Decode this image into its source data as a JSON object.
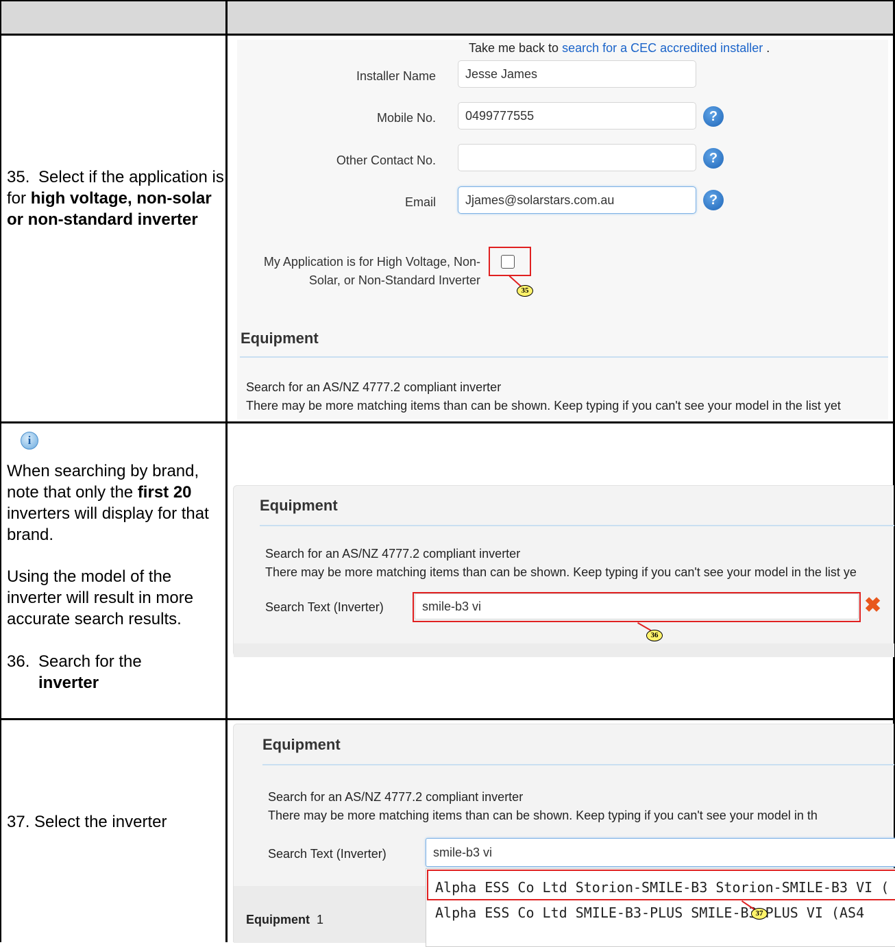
{
  "row35": {
    "instruction_num": "35.",
    "instruction_pre": "Select if the application is for ",
    "instruction_bold": "high voltage, non-solar or non-standard inverter",
    "take_me_back": "Take me back to ",
    "link_text": "search for a CEC accredited installer",
    "link_after": ".",
    "installer_name_label": "Installer Name",
    "installer_name_value": "Jesse James",
    "mobile_label": "Mobile No.",
    "mobile_value": "0499777555",
    "other_contact_label": "Other Contact No.",
    "other_contact_value": "",
    "email_label": "Email",
    "email_value": "Jjames@solarstars.com.au",
    "hv_label_line1": "My Application is for High Voltage, Non-",
    "hv_label_line2": "Solar, or Non-Standard Inverter",
    "badge": "35",
    "equipment_heading": "Equipment",
    "search_line1": "Search for an AS/NZ 4777.2 compliant inverter",
    "search_line2": "There may be more matching items than can be shown. Keep typing if you can't see your model in the list yet"
  },
  "row36": {
    "note_line1": "When searching by brand, note that only the ",
    "note_bold": "first 20",
    "note_line2": " inverters will display for that brand.",
    "note2": "Using the model of the inverter will result in more accurate search results.",
    "instruction_num": "36.",
    "instruction_pre": "Search for the ",
    "instruction_bold": "inverter",
    "equipment_heading": "Equipment",
    "search_line1": "Search for an AS/NZ 4777.2 compliant inverter",
    "search_line2": "There may be more matching items than can be shown. Keep typing if you can't see your model in the list ye",
    "search_label": "Search Text (Inverter)",
    "search_value": "smile-b3 vi",
    "badge": "36"
  },
  "row37": {
    "instruction": "37. Select the inverter",
    "equipment_heading": "Equipment",
    "search_line1": "Search for an AS/NZ 4777.2 compliant inverter",
    "search_line2": "There may be more matching items than can be shown. Keep typing if you can't see your model in th",
    "search_label": "Search Text (Inverter)",
    "search_value": "smile-b3 vi",
    "option1": "Alpha ESS Co Ltd Storion-SMILE-B3 Storion-SMILE-B3 VI (",
    "option2": "Alpha ESS Co Ltd SMILE-B3-PLUS SMILE-B3-PLUS VI (AS4",
    "equipment_tab": "Equipment",
    "equipment_count": "1",
    "badge": "37"
  },
  "icons": {
    "help": "question-icon",
    "info": "info-icon",
    "clear": "close-icon"
  },
  "colors": {
    "link": "#1a63c9",
    "highlight": "#e02020",
    "badge": "#fff36b",
    "header": "#d9d9d9"
  }
}
